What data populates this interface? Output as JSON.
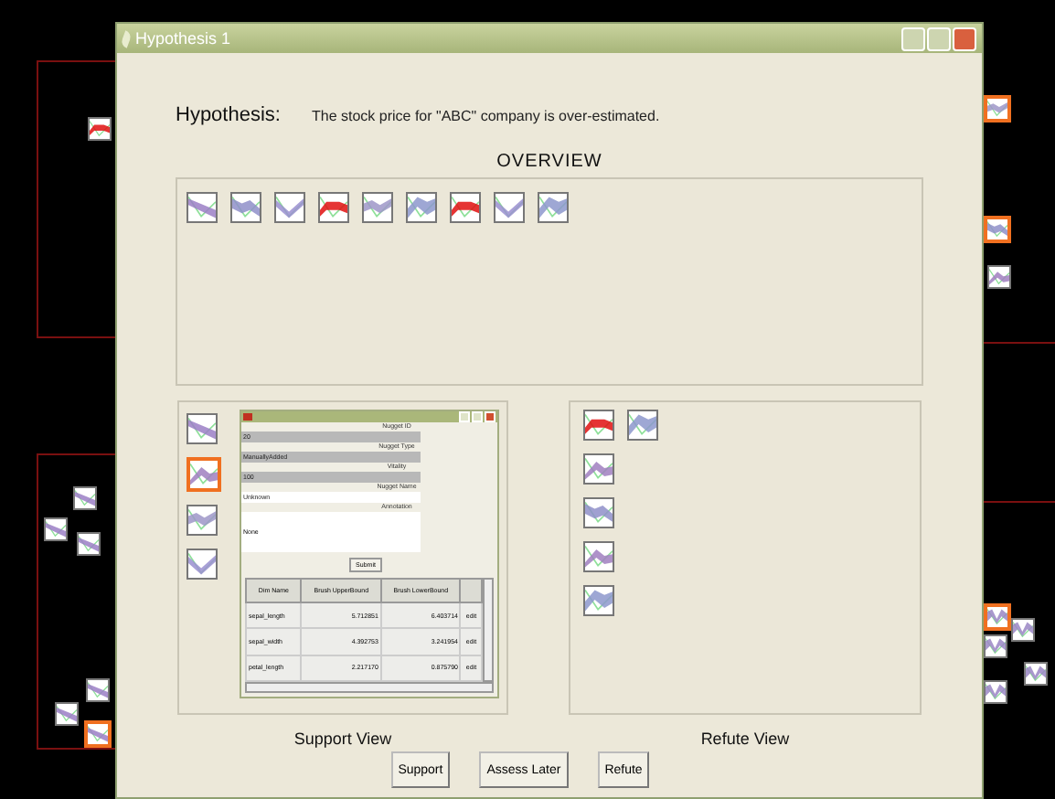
{
  "window": {
    "title": "Hypothesis 1"
  },
  "hypothesis": {
    "label": "Hypothesis:",
    "text": "The stock price for \"ABC\" company is over-estimated."
  },
  "overview": {
    "title": "OVERVIEW",
    "thumbnails": [
      {
        "kind": "fall",
        "selected": false
      },
      {
        "kind": "dip",
        "selected": false
      },
      {
        "kind": "valley",
        "selected": false
      },
      {
        "kind": "ribbon",
        "selected": false
      },
      {
        "kind": "wave",
        "selected": false
      },
      {
        "kind": "peak",
        "selected": false
      },
      {
        "kind": "ribbon",
        "selected": false
      },
      {
        "kind": "valley",
        "selected": false
      },
      {
        "kind": "peak",
        "selected": false
      }
    ]
  },
  "support_view": {
    "title": "Support View",
    "thumbnails": [
      {
        "kind": "fall",
        "selected": false
      },
      {
        "kind": "hump",
        "selected": true
      },
      {
        "kind": "wave",
        "selected": false
      },
      {
        "kind": "valley",
        "selected": false
      }
    ],
    "dialog": {
      "fields": [
        {
          "label": "Nugget ID",
          "value": "20",
          "editable": false
        },
        {
          "label": "Nugget Type",
          "value": "ManuallyAdded",
          "editable": false
        },
        {
          "label": "Vitality",
          "value": "100",
          "editable": false
        },
        {
          "label": "Nugget Name",
          "value": "Unknown",
          "editable": true
        }
      ],
      "annotation": {
        "label": "Annotation",
        "value": "None"
      },
      "submit": "Submit",
      "table": {
        "columns": [
          "Dim Name",
          "Brush UpperBound",
          "Brush LowerBound"
        ],
        "rows": [
          [
            "sepal_length",
            "5.712851",
            "6.403714",
            "edit"
          ],
          [
            "sepal_width",
            "4.392753",
            "3.241954",
            "edit"
          ],
          [
            "petal_length",
            "2.217170",
            "0.875790",
            "edit"
          ]
        ]
      }
    }
  },
  "refute_view": {
    "title": "Refute View",
    "thumbnails": [
      {
        "kind": "ribbon",
        "selected": false
      },
      {
        "kind": "peak",
        "selected": false
      },
      {
        "kind": "hump",
        "selected": false
      },
      {
        "kind": "dip",
        "selected": false
      },
      {
        "kind": "hump",
        "selected": false
      },
      {
        "kind": "peak",
        "selected": false
      }
    ]
  },
  "buttons": [
    "Support",
    "Assess Later",
    "Refute"
  ],
  "canvas": {
    "thumbnails": [
      {
        "kind": "ribbon",
        "selected": false
      },
      {
        "kind": "fall",
        "selected": false
      },
      {
        "kind": "fall",
        "selected": false
      },
      {
        "kind": "fall",
        "selected": false
      },
      {
        "kind": "fall",
        "selected": false
      },
      {
        "kind": "fall",
        "selected": false
      },
      {
        "kind": "fall",
        "selected": true
      },
      {
        "kind": "wave",
        "selected": true
      },
      {
        "kind": "dip",
        "selected": true
      },
      {
        "kind": "hump",
        "selected": false
      },
      {
        "kind": "zigzag",
        "selected": true
      },
      {
        "kind": "zigzag",
        "selected": false
      },
      {
        "kind": "zigzag",
        "selected": false
      },
      {
        "kind": "zigzag",
        "selected": false
      },
      {
        "kind": "zigzag",
        "selected": false
      }
    ]
  }
}
